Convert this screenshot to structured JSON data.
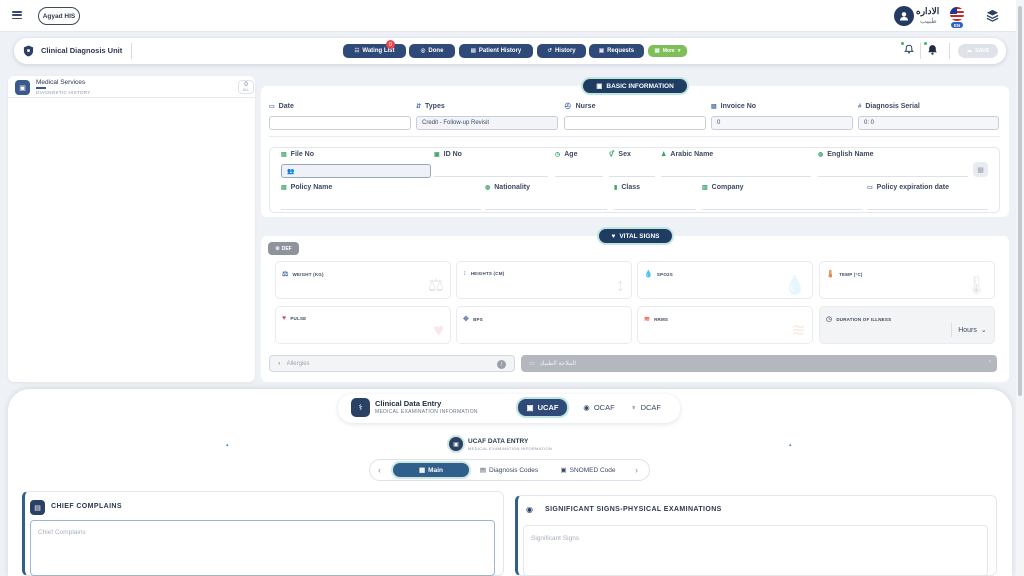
{
  "topbar": {
    "brand": "Agyad HIS",
    "user_name": "الاداره",
    "user_role": "طبيب",
    "language_badge": "EN"
  },
  "unitbar": {
    "title": "Clinical Diagnosis Unit",
    "waiting_count": "0",
    "buttons": {
      "waiting_list": "Wating List",
      "done": "Done",
      "patient_history": "Patient History",
      "history": "History",
      "requests": "Requests",
      "more": "More"
    },
    "save_label": "SAVE"
  },
  "left_panel": {
    "title": "Medical Services",
    "subtitle": "DIAGNOSTIC HISTORY",
    "count": "0",
    "count_label": "ALL"
  },
  "basic_info": {
    "section_title": "BASIC INFORMATION",
    "labels": {
      "date": "Date",
      "types": "Types",
      "nurse": "Nurse",
      "invoice_no": "Invoice No",
      "diagnosis_serial": "Diagnosis Serial",
      "file_no": "File No",
      "id_no": "ID No",
      "age": "Age",
      "sex": "Sex",
      "arabic_name": "Arabic Name",
      "english_name": "English Name",
      "policy_name": "Policy Name",
      "nationality": "Nationality",
      "class": "Class",
      "company": "Company",
      "policy_expiration_date": "Policy expiration date"
    },
    "values": {
      "date": "",
      "types": "Credit - Follow-up Revisit",
      "nurse": "",
      "invoice_no": "0",
      "diagnosis_serial": "0: 0"
    }
  },
  "vital_signs": {
    "section_title": "VITAL SIGNS",
    "def_label": "DEF",
    "cards": {
      "weight": "WEIGHT (KG)",
      "heights": "HEIGHTS (CM)",
      "spo2": "SPO2S",
      "temp": "TEMP (°C)",
      "pulse": "PULSE",
      "bps": "BPS",
      "rrms": "RRMS",
      "duration": "DURATION OF ILLNESS"
    },
    "duration_unit": "Hours",
    "allergies_placeholder": "Allergies",
    "arabic_notes_placeholder": "الملاحة الطبيك"
  },
  "clinical_entry": {
    "title": "Clinical Data Entry",
    "subtitle": "MEDICAL EXAMINATION INFORMATION",
    "tabs": {
      "ucaf": "UCAF",
      "ocaf": "OCAF",
      "dcaf": "DCAF"
    },
    "ucaf_title": "UCAF DATA ENTRY",
    "ucaf_subtitle": "MEDICAL EXAMINATION INFORMATION",
    "sub_tabs": {
      "main": "Main",
      "diagnosis_codes": "Diagnosis Codes",
      "snomed": "SNOMED Code"
    },
    "chief_title": "CHIEF COMPLAINS",
    "chief_placeholder": "Chief Complains",
    "signs_title": "SIGNIFICANT SIGNS-PHYSICAL EXAMINATIONS",
    "signs_placeholder": "Significant Signs"
  }
}
